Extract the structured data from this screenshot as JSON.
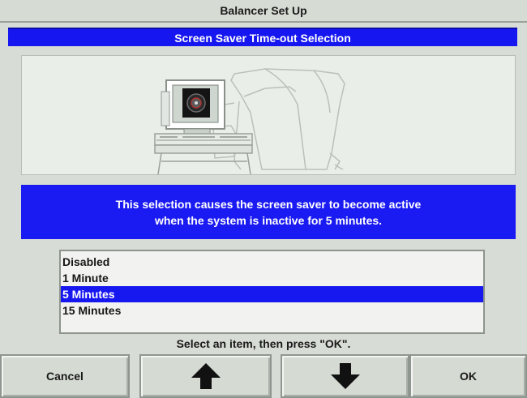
{
  "window": {
    "title": "Balancer Set Up"
  },
  "section": {
    "title": "Screen Saver Time-out Selection"
  },
  "message": {
    "line1": "This selection causes the screen saver to become active",
    "line2": "when the system is inactive for 5 minutes."
  },
  "list": {
    "items": [
      {
        "label": "Disabled"
      },
      {
        "label": "1 Minute"
      },
      {
        "label": "5 Minutes"
      },
      {
        "label": "15 Minutes"
      }
    ],
    "selected": "5 Minutes"
  },
  "hint": "Select an item, then press \"OK\".",
  "buttons": {
    "cancel": "Cancel",
    "up_icon": "arrow-up-icon",
    "down_icon": "arrow-down-icon",
    "ok": "OK"
  },
  "colors": {
    "accent_blue": "#1616f0",
    "panel_gray": "#d8dcd6"
  }
}
